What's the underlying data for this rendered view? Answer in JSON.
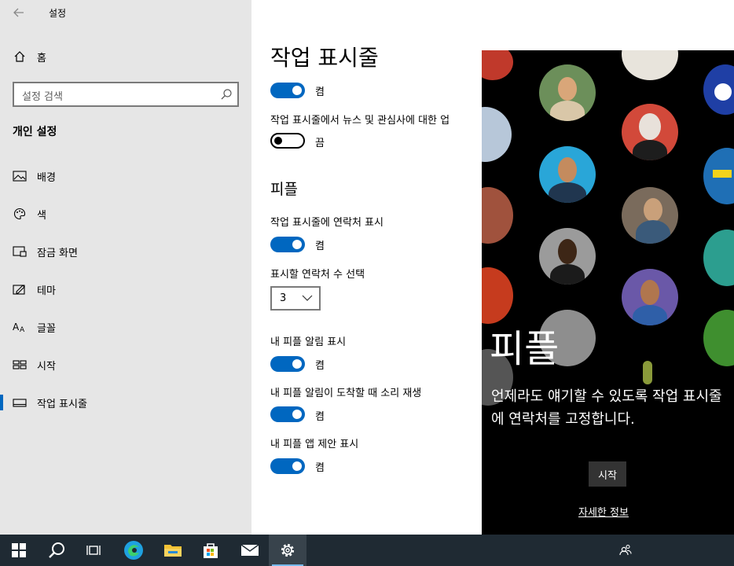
{
  "window": {
    "title": "설정"
  },
  "sidebar": {
    "home_label": "홈",
    "search_placeholder": "설정 검색",
    "section_title": "개인 설정",
    "items": [
      {
        "label": "배경",
        "icon": "image-icon"
      },
      {
        "label": "색",
        "icon": "palette-icon"
      },
      {
        "label": "잠금 화면",
        "icon": "lock-screen-icon"
      },
      {
        "label": "테마",
        "icon": "theme-icon"
      },
      {
        "label": "글꼴",
        "icon": "font-icon"
      },
      {
        "label": "시작",
        "icon": "start-icon"
      },
      {
        "label": "작업 표시줄",
        "icon": "taskbar-icon",
        "active": true
      }
    ]
  },
  "main": {
    "page_title": "작업 표시줄",
    "toggle1_state": "켬",
    "news_label": "작업 표시줄에서 뉴스 및 관심사에 대한 업",
    "news_state": "끔",
    "people_heading": "피플",
    "show_contacts_label": "작업 표시줄에 연락처 표시",
    "show_contacts_state": "켬",
    "contact_count_label": "표시할 연락처 수 선택",
    "contact_count_value": "3",
    "notifications_label": "내 피플 알림 표시",
    "notifications_state": "켬",
    "sound_label": "내 피플 알림이 도착할 때 소리 재생",
    "sound_state": "켬",
    "suggestions_label": "내 피플 앱 제안 표시",
    "suggestions_state": "켬"
  },
  "flyout": {
    "title": "피플",
    "description": "언제라도 얘기할 수 있도록 작업 표시줄에 연락처를 고정합니다.",
    "start_button": "시작",
    "learn_more_link": "자세한 정보"
  },
  "colors": {
    "accent": "#0067c0",
    "sidebar_bg": "#e6e6e6",
    "taskbar_bg": "#1f2a33"
  },
  "taskbar": {
    "items": [
      "windows-start-icon",
      "search-icon",
      "task-view-icon",
      "edge-icon",
      "file-explorer-icon",
      "store-icon",
      "mail-icon",
      "settings-icon"
    ],
    "tray": [
      "people-icon"
    ]
  }
}
